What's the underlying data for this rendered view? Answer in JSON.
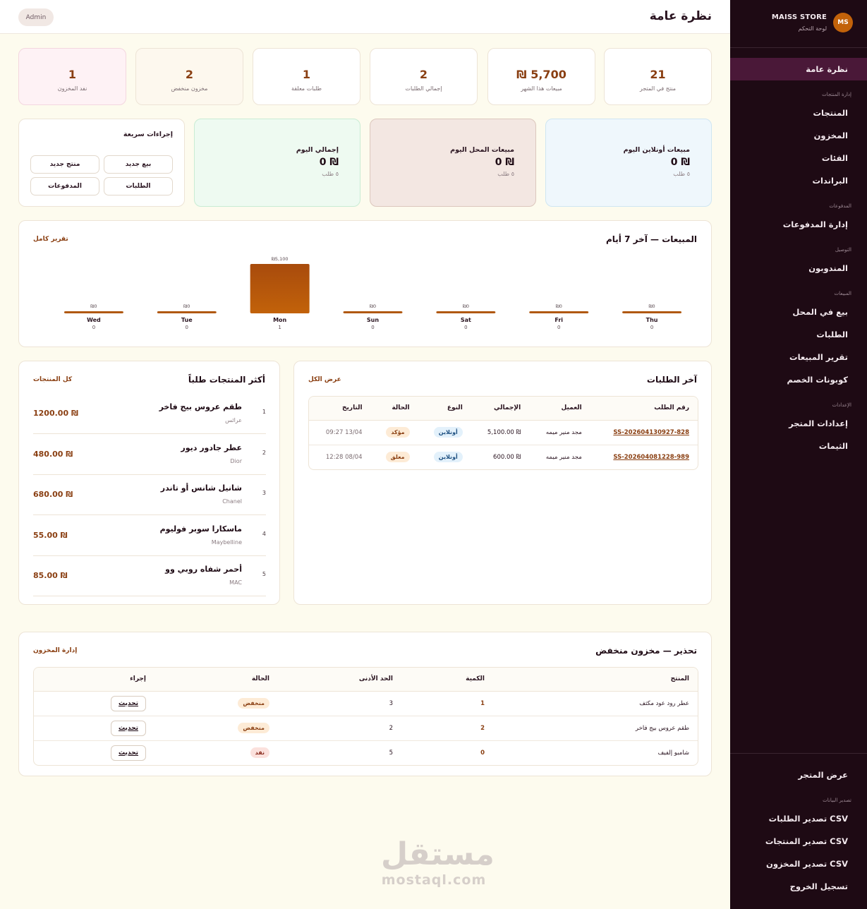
{
  "sidebar": {
    "brand_name": "MAISS STORE",
    "brand_sub": "لوحة التحكم",
    "avatar": "MS",
    "items": [
      {
        "type": "item",
        "label": "نظرة عامة",
        "active": true
      },
      {
        "type": "section",
        "label": "إدارة المنتجات"
      },
      {
        "type": "item",
        "label": "المنتجات"
      },
      {
        "type": "item",
        "label": "المخزون"
      },
      {
        "type": "item",
        "label": "الفئات"
      },
      {
        "type": "item",
        "label": "البراندات"
      },
      {
        "type": "section",
        "label": "المدفوعات"
      },
      {
        "type": "item",
        "label": "إدارة المدفوعات"
      },
      {
        "type": "section",
        "label": "التوصيل"
      },
      {
        "type": "item",
        "label": "المندوبون"
      },
      {
        "type": "section",
        "label": "المبيعات"
      },
      {
        "type": "item",
        "label": "بيع في المحل"
      },
      {
        "type": "item",
        "label": "الطلبات"
      },
      {
        "type": "item",
        "label": "تقرير المبيعات"
      },
      {
        "type": "item",
        "label": "كوبونات الخصم"
      },
      {
        "type": "section",
        "label": "الإعدادات"
      },
      {
        "type": "item",
        "label": "إعدادات المتجر"
      },
      {
        "type": "item",
        "label": "الثيمات"
      }
    ],
    "bottom": [
      {
        "type": "item",
        "label": "عرض المتجر"
      },
      {
        "type": "section",
        "label": "تصدير البيانات"
      },
      {
        "type": "item",
        "label": "تصدير الطلبات CSV"
      },
      {
        "type": "item",
        "label": "تصدير المنتجات CSV"
      },
      {
        "type": "item",
        "label": "تصدير المخزون CSV"
      },
      {
        "type": "item",
        "label": "تسجيل الخروج"
      }
    ]
  },
  "header": {
    "title": "نظرة عامة",
    "admin": "Admin"
  },
  "stats": [
    {
      "value": "21",
      "label": "منتج في المتجر"
    },
    {
      "value": "5,700 ₪",
      "label": "مبيعات هذا الشهر"
    },
    {
      "value": "2",
      "label": "إجمالي الطلبات"
    },
    {
      "value": "1",
      "label": "طلبات معلقة"
    },
    {
      "value": "2",
      "label": "مخزون منخفض"
    },
    {
      "value": "1",
      "label": "نفد المخزون"
    }
  ],
  "summaries": [
    {
      "title": "مبيعات أونلاين اليوم",
      "value": "₪ 0",
      "sub": "٥ طلب"
    },
    {
      "title": "مبيعات المحل اليوم",
      "value": "₪ 0",
      "sub": "٥ طلب"
    },
    {
      "title": "إجمالي اليوم",
      "value": "₪ 0",
      "sub": "٥ طلب"
    }
  ],
  "quick_actions": {
    "title": "إجراءات سريعة",
    "buttons": [
      "بيع جديد",
      "منتج جديد",
      "الطلبات",
      "المدفوعات"
    ]
  },
  "chart_card": {
    "title": "المبيعات — آخر 7 أيام",
    "link": "تقرير كامل"
  },
  "chart_data": {
    "type": "bar",
    "categories": [
      "Thu",
      "Fri",
      "Sat",
      "Sun",
      "Mon",
      "Tue",
      "Wed"
    ],
    "values": [
      0,
      0,
      0,
      0,
      5100,
      0,
      0
    ],
    "value_labels": [
      "₪0",
      "₪0",
      "₪0",
      "₪0",
      "₪5,100",
      "₪0",
      "₪0"
    ],
    "counts": [
      "0",
      "0",
      "0",
      "0",
      "1",
      "0",
      "0"
    ],
    "bar_color": "#c2620a",
    "grid": false
  },
  "orders": {
    "title": "آخر الطلبات",
    "link": "عرض الكل",
    "headers": [
      "رقم الطلب",
      "العميل",
      "الإجمالي",
      "النوع",
      "الحالة",
      "التاريخ"
    ],
    "rows": [
      {
        "id": "SS-202604130927-828",
        "customer": "مجد منير ميمه",
        "total": "₪ 5,100.00",
        "type": "أونلاين",
        "status": "مؤكد",
        "date": "13/04 09:27"
      },
      {
        "id": "SS-202604081228-989",
        "customer": "مجد منير ميمه",
        "total": "₪ 600.00",
        "type": "أونلاين",
        "status": "معلق",
        "date": "08/04 12:28"
      }
    ]
  },
  "top_products": {
    "title": "أكثر المنتجات طلباً",
    "link": "كل المنتجات",
    "items": [
      {
        "rank": "1",
        "name": "طقم عروس بيج فاخر",
        "brand": "عرائس",
        "price": "₪ 1200.00"
      },
      {
        "rank": "2",
        "name": "عطر جادور ديور",
        "brand": "Dior",
        "price": "₪ 480.00"
      },
      {
        "rank": "3",
        "name": "شانيل شانس أو تاندر",
        "brand": "Chanel",
        "price": "₪ 680.00"
      },
      {
        "rank": "4",
        "name": "ماسكارا سوبر فوليوم",
        "brand": "Maybelline",
        "price": "₪ 55.00"
      },
      {
        "rank": "5",
        "name": "أحمر شفاه روبي وو",
        "brand": "MAC",
        "price": "₪ 85.00"
      }
    ]
  },
  "low_stock": {
    "title": "تحذير — مخزون منخفض",
    "link": "إدارة المخزون",
    "headers": [
      "المنتج",
      "الكمية",
      "الحد الأدنى",
      "الحالة",
      "إجراء"
    ],
    "rows": [
      {
        "product": "عطر رود عود مكثف",
        "qty": "1",
        "min": "3",
        "status": "منخفض",
        "action": "تحديث"
      },
      {
        "product": "طقم عروس بيج فاخر",
        "qty": "2",
        "min": "2",
        "status": "منخفض",
        "action": "تحديث"
      },
      {
        "product": "شامبو إلفيف",
        "qty": "0",
        "min": "5",
        "status": "نفد",
        "action": "تحديث"
      }
    ]
  },
  "watermark": {
    "ar": "مستقل",
    "en": "mostaql.com"
  },
  "colors": {
    "sidebar": "#1e0a14",
    "accent": "#8a3f12",
    "bar": "#c2620a",
    "background": "#fdfbee"
  }
}
